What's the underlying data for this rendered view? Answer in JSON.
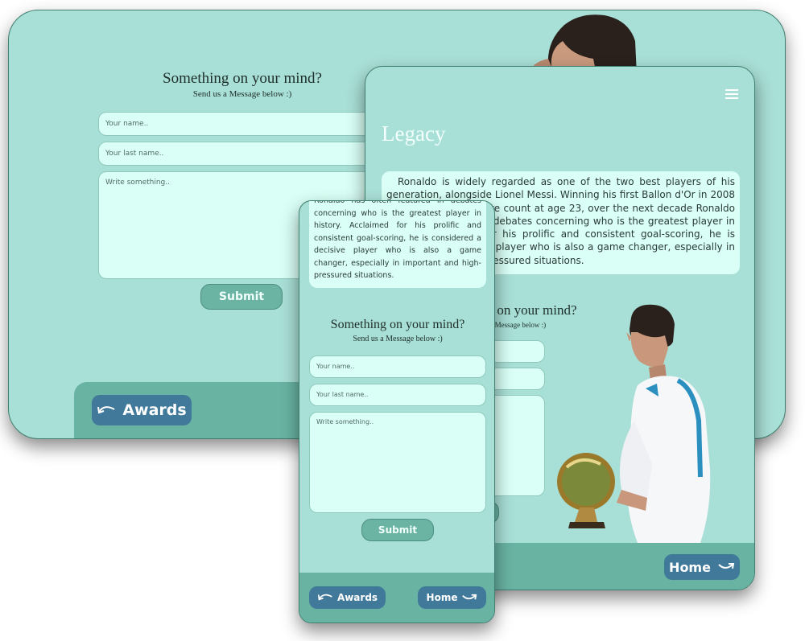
{
  "contact": {
    "heading": "Something on your mind?",
    "subheading": "Send us a Message below :)",
    "name_placeholder": "Your name..",
    "lastname_placeholder": "Your last name..",
    "message_placeholder": "Write something..",
    "submit_label": "Submit"
  },
  "legacy": {
    "title": "Legacy",
    "paragraph": "Ronaldo is widely regarded as one of the two best players of his generation, alongside Lionel Messi. Winning his first Ballon d'Or in 2008 with a record-high vote count at age 23, over the next decade Ronaldo has often featured in debates concerning who is the greatest player in history. Acclaimed for his prolific and consistent goal-scoring, he is considered a decisive player who is also a game changer, especially in important and high-pressured situations.",
    "mobile_excerpt": "Ronaldo has often featured in debates concerning who is the greatest player in history. Acclaimed for his prolific and consistent goal-scoring, he is considered a decisive player who is also a game changer, especially in important and high-pressured situations."
  },
  "nav": {
    "awards_label": "Awards",
    "home_label": "Home",
    "menu_icon": "hamburger-icon",
    "awards_icon": "arrow-curve-left-icon",
    "home_icon": "arrow-curve-right-icon"
  },
  "colors": {
    "background": "#a8dfd6",
    "footer": "#69b3a3",
    "nav_button": "#40799a",
    "input": "#d9fff6",
    "submit": "#6bb4a4"
  }
}
